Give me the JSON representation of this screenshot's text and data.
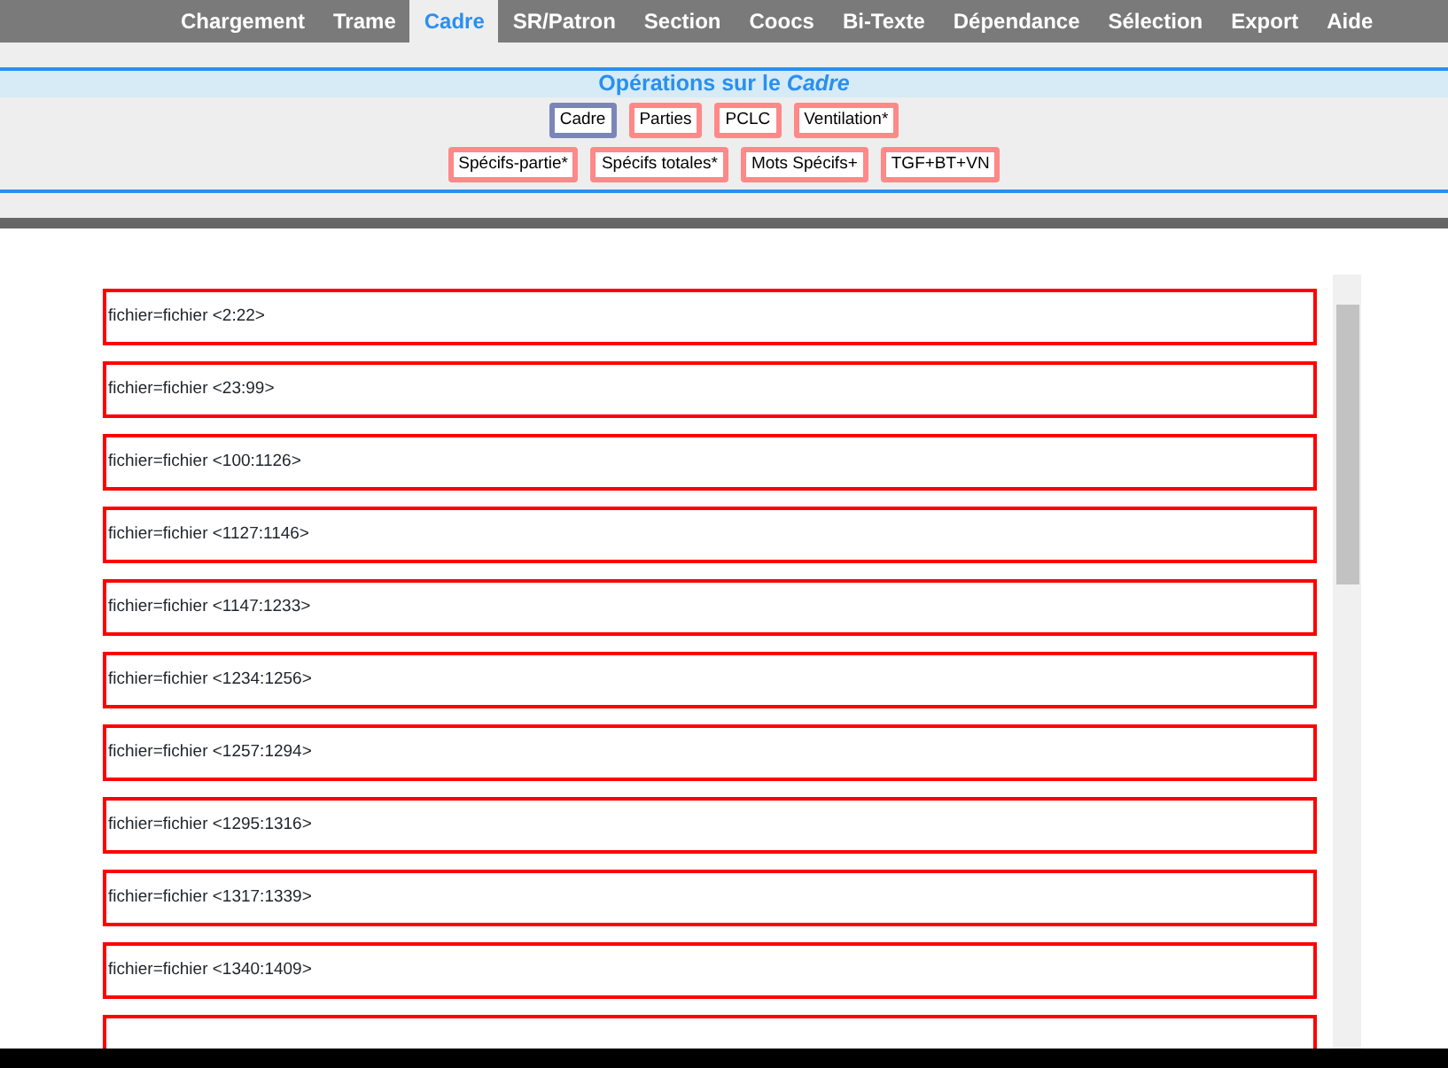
{
  "tabs": [
    {
      "label": "Chargement",
      "selected": false
    },
    {
      "label": "Trame",
      "selected": false
    },
    {
      "label": "Cadre",
      "selected": true
    },
    {
      "label": "SR/Patron",
      "selected": false
    },
    {
      "label": "Section",
      "selected": false
    },
    {
      "label": "Coocs",
      "selected": false
    },
    {
      "label": "Bi-Texte",
      "selected": false
    },
    {
      "label": "Dépendance",
      "selected": false
    },
    {
      "label": "Sélection",
      "selected": false
    },
    {
      "label": "Export",
      "selected": false
    },
    {
      "label": "Aide",
      "selected": false
    }
  ],
  "operations": {
    "title": "Opérations sur le *Cadre*",
    "button_rows": [
      [
        {
          "label": "Cadre",
          "selected": true
        },
        {
          "label": "Parties",
          "selected": false
        },
        {
          "label": "PCLC",
          "selected": false
        },
        {
          "label": "Ventilation*",
          "selected": false
        }
      ],
      [
        {
          "label": "Spécifs-partie*",
          "selected": false
        },
        {
          "label": "Spécifs totales*",
          "selected": false
        },
        {
          "label": "Mots Spécifs+",
          "selected": false
        },
        {
          "label": "TGF+BT+VN",
          "selected": false
        }
      ]
    ]
  },
  "sections": [
    "fichier=fichier <2:22>",
    "fichier=fichier <23:99>",
    "fichier=fichier <100:1126>",
    "fichier=fichier <1127:1146>",
    "fichier=fichier <1147:1233>",
    "fichier=fichier <1234:1256>",
    "fichier=fichier <1257:1294>",
    "fichier=fichier <1295:1316>",
    "fichier=fichier <1317:1339>",
    "fichier=fichier <1340:1409>"
  ],
  "more_sections_below": true
}
